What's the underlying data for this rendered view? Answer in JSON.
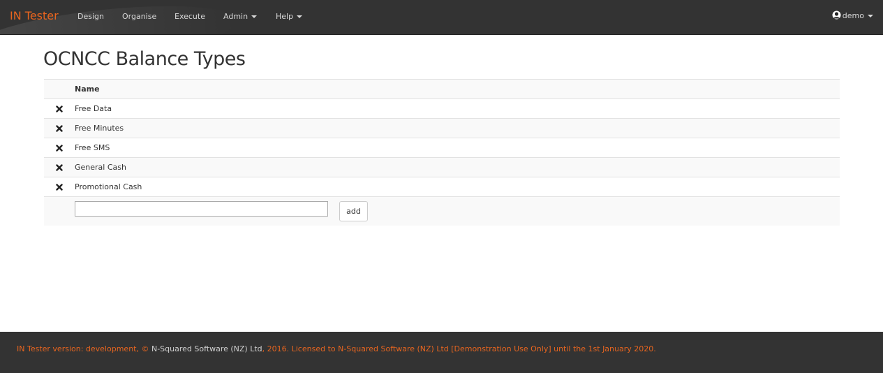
{
  "navbar": {
    "brand": "IN Tester",
    "items": [
      {
        "label": "Design",
        "dropdown": false
      },
      {
        "label": "Organise",
        "dropdown": false
      },
      {
        "label": "Execute",
        "dropdown": false
      },
      {
        "label": "Admin",
        "dropdown": true
      },
      {
        "label": "Help",
        "dropdown": true
      }
    ],
    "user": "demo",
    "user_icon": "user-silhouette-icon"
  },
  "page": {
    "title": "OCNCC Balance Types"
  },
  "table": {
    "header": "Name",
    "rows": [
      {
        "name": "Free Data",
        "delete_icon": "cross-icon"
      },
      {
        "name": "Free Minutes",
        "delete_icon": "cross-icon"
      },
      {
        "name": "Free SMS",
        "delete_icon": "cross-icon"
      },
      {
        "name": "General Cash",
        "delete_icon": "cross-icon"
      },
      {
        "name": "Promotional Cash",
        "delete_icon": "cross-icon"
      }
    ],
    "new_name_value": "",
    "add_label": "add"
  },
  "footer": {
    "part1": "IN Tester version: development, © ",
    "owner": "N-Squared Software (NZ) Ltd",
    "part2": ", 2016. Licensed to N-Squared Software (NZ) Ltd [Demonstration Use Only] until the 1st January 2020."
  },
  "colors": {
    "accent": "#e8651f",
    "navbar_bg": "#333333",
    "footer_bg": "#333333"
  }
}
